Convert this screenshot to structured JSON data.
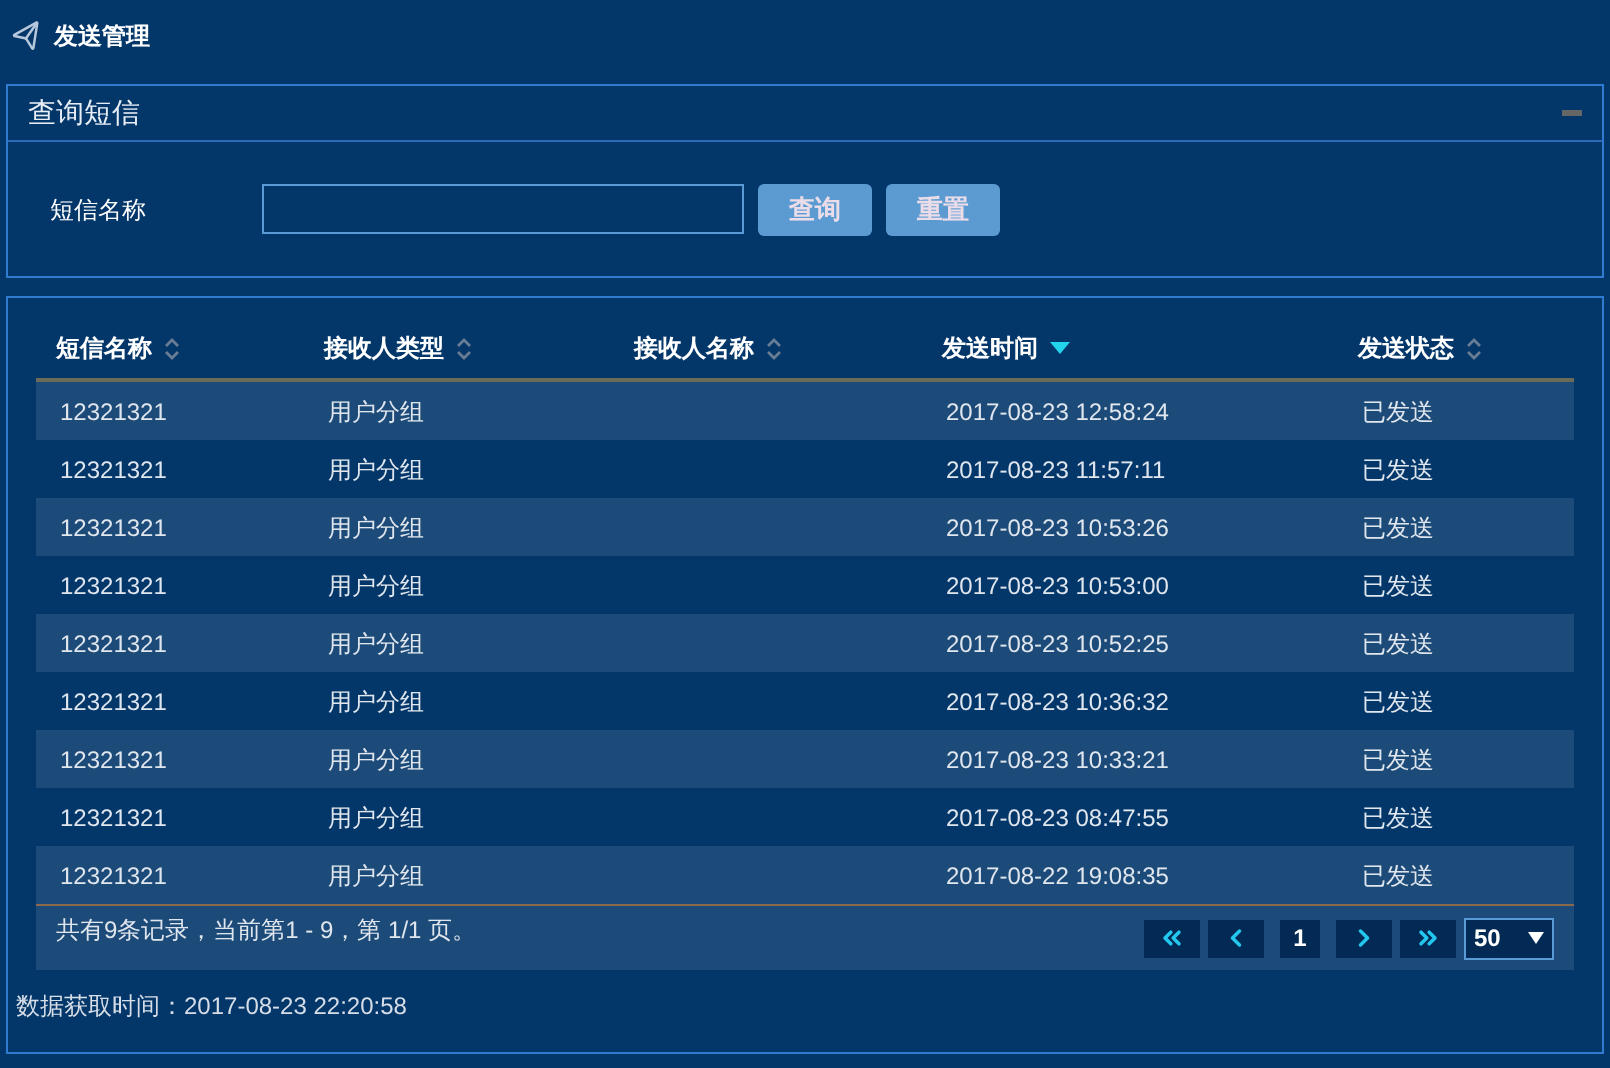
{
  "page_title": "发送管理",
  "query_panel": {
    "title": "查询短信",
    "field_label": "短信名称",
    "buttons": [
      "查询",
      "重置"
    ]
  },
  "table": {
    "columns": [
      {
        "label": "短信名称",
        "sorted": false
      },
      {
        "label": "接收人类型",
        "sorted": false
      },
      {
        "label": "接收人名称",
        "sorted": false
      },
      {
        "label": "发送时间",
        "sorted": true
      },
      {
        "label": "发送状态",
        "sorted": false
      }
    ],
    "rows": [
      [
        "12321321",
        "用户分组",
        "",
        "2017-08-23 12:58:24",
        "已发送"
      ],
      [
        "12321321",
        "用户分组",
        "",
        "2017-08-23 11:57:11",
        "已发送"
      ],
      [
        "12321321",
        "用户分组",
        "",
        "2017-08-23 10:53:26",
        "已发送"
      ],
      [
        "12321321",
        "用户分组",
        "",
        "2017-08-23 10:53:00",
        "已发送"
      ],
      [
        "12321321",
        "用户分组",
        "",
        "2017-08-23 10:52:25",
        "已发送"
      ],
      [
        "12321321",
        "用户分组",
        "",
        "2017-08-23 10:36:32",
        "已发送"
      ],
      [
        "12321321",
        "用户分组",
        "",
        "2017-08-23 10:33:21",
        "已发送"
      ],
      [
        "12321321",
        "用户分组",
        "",
        "2017-08-23 08:47:55",
        "已发送"
      ],
      [
        "12321321",
        "用户分组",
        "",
        "2017-08-22 19:08:35",
        "已发送"
      ]
    ]
  },
  "pagination": {
    "summary": "共有9条记录，当前第1 - 9，第 1/1 页。",
    "buttons": [
      {
        "kind": "first"
      },
      {
        "kind": "prev"
      },
      {
        "kind": "page",
        "label": "1",
        "selected": true
      },
      {
        "kind": "next"
      },
      {
        "kind": "last"
      }
    ],
    "page_size": "50"
  },
  "fetch_time": "数据获取时间：2017-08-23 22:20:58"
}
